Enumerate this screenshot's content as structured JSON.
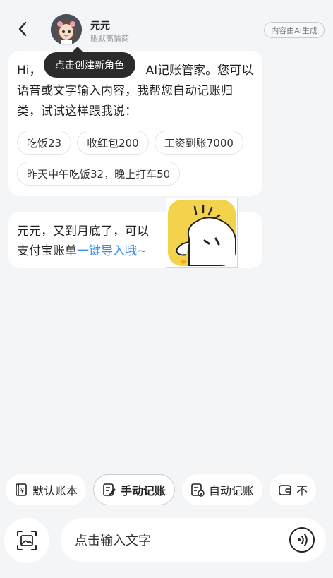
{
  "header": {
    "name": "元元",
    "subtitle": "幽默高情商",
    "ai_badge": "内容由AI生成"
  },
  "tooltip": "点击创建新角色",
  "message1": {
    "text_pre": "Hi，",
    "text_post": "AI记账管家。您可以语音或文字输入内容，我帮您自动记账归类，试试这样跟我说：",
    "chips": [
      "吃饭23",
      "收红包200",
      "工资到账7000",
      "昨天中午吃饭32，晚上打车50"
    ]
  },
  "message2": {
    "text": "元元，又到月底了，可以",
    "text_tail": "支付宝账单",
    "link": "一键导入哦~"
  },
  "actions": [
    {
      "label": "默认账本",
      "icon": "ledger-icon"
    },
    {
      "label": "手动记账",
      "icon": "edit-note-icon"
    },
    {
      "label": "自动记账",
      "icon": "auto-bill-icon"
    },
    {
      "label": "不",
      "icon": "wallet-icon"
    }
  ],
  "input": {
    "placeholder": "点击输入文字"
  },
  "colors": {
    "link": "#3d8bea",
    "mascot_yellow": "#f3d34b"
  }
}
